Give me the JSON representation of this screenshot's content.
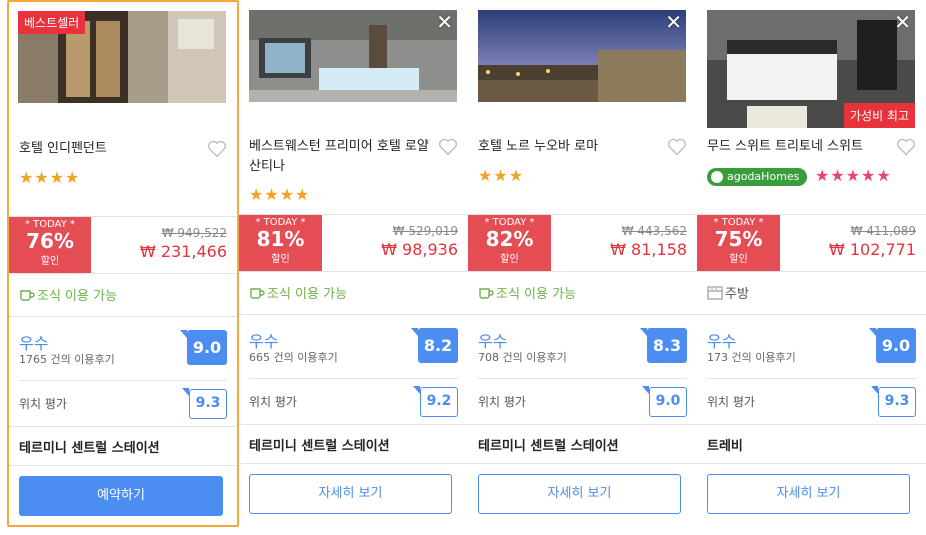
{
  "colors": {
    "accent_blue": "#4b8df0",
    "deal_red": "#e54d55",
    "price_red": "#e8323c",
    "star_orange": "#f4a224",
    "star_pink": "#e8476a",
    "amenity_green": "#6eb34a",
    "selected_border": "#f5a93b",
    "agoda_homes_green": "#3a9d3c"
  },
  "hotels": [
    {
      "badge": "베스트셀러",
      "name": "호텔 인디펜던트",
      "stars": "★★★★",
      "today": "* TODAY *",
      "discount": "76%",
      "discount_label": "할인",
      "old_price": "₩ 949,522",
      "new_price": "₩ 231,466",
      "amenity": "조식 이용 가능",
      "amenity_icon": "cup-icon",
      "rating_word": "우수",
      "reviews": "1765 건의 이용후기",
      "score": "9.0",
      "location_label": "위치 평가",
      "location_score": "9.3",
      "station": "테르미니 센트럴 스테이션",
      "button": "예약하기"
    },
    {
      "name": "베스트웨스턴 프리미어 호텔 로얄 산티나",
      "stars": "★★★★",
      "today": "* TODAY *",
      "discount": "81%",
      "discount_label": "할인",
      "old_price": "₩ 529,019",
      "new_price": "₩ 98,936",
      "amenity": "조식 이용 가능",
      "amenity_icon": "cup-icon",
      "rating_word": "우수",
      "reviews": "665 건의 이용후기",
      "score": "8.2",
      "location_label": "위치 평가",
      "location_score": "9.2",
      "station": "테르미니 센트럴 스테이션",
      "button": "자세히 보기",
      "close": "✕"
    },
    {
      "name": "호텔 노르 누오바 로마",
      "stars": "★★★",
      "today": "* TODAY *",
      "discount": "82%",
      "discount_label": "할인",
      "old_price": "₩ 443,562",
      "new_price": "₩ 81,158",
      "amenity": "조식 이용 가능",
      "amenity_icon": "cup-icon",
      "rating_word": "우수",
      "reviews": "708 건의 이용후기",
      "score": "8.3",
      "location_label": "위치 평가",
      "location_score": "9.0",
      "station": "테르미니 센트럴 스테이션",
      "button": "자세히 보기",
      "close": "✕"
    },
    {
      "name": "무드 스위트 트리토네 스위트",
      "badge_bottom": "가성비 최고",
      "agoda_homes": "agodaHomes",
      "stars": "★★★★★",
      "star_rating": 4.5,
      "today": "* TODAY *",
      "discount": "75%",
      "discount_label": "할인",
      "old_price": "₩ 411,089",
      "new_price": "₩ 102,771",
      "amenity": "주방",
      "amenity_icon": "kitchen-icon",
      "rating_word": "우수",
      "reviews": "173 건의 이용후기",
      "score": "9.0",
      "location_label": "위치 평가",
      "location_score": "9.3",
      "station": "트레비",
      "button": "자세히 보기",
      "close": "✕"
    }
  ]
}
